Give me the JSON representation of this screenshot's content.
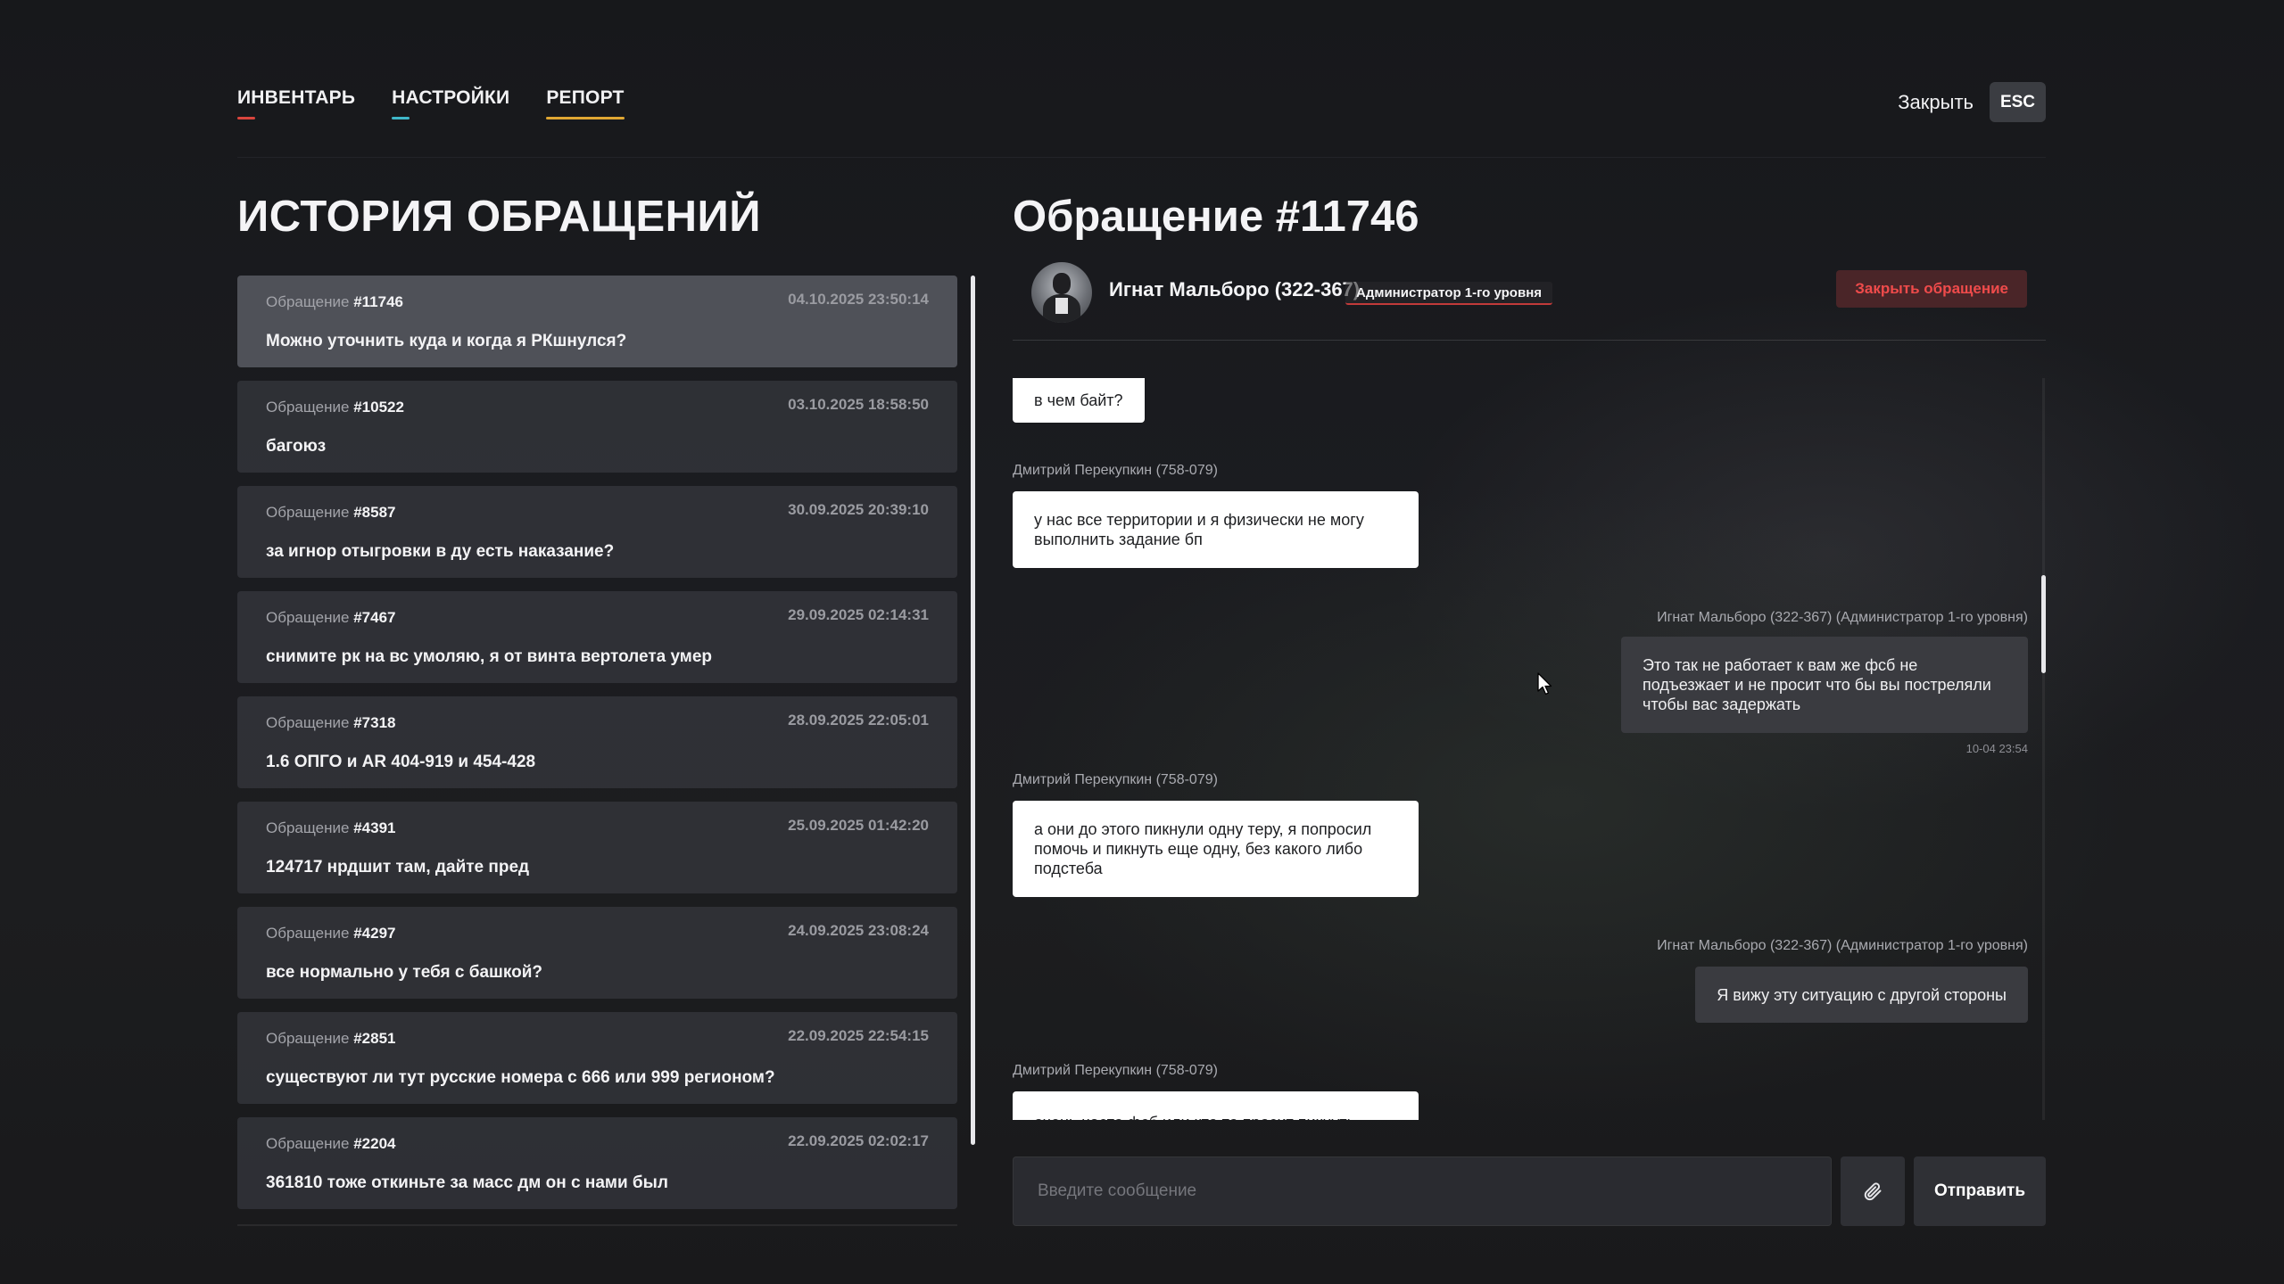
{
  "nav": {
    "tabs": [
      {
        "label": "ИНВЕНТАРЬ",
        "accent": "#d9453d"
      },
      {
        "label": "НАСТРОЙКИ",
        "accent": "#3fb7c9"
      },
      {
        "label": "РЕПОРТ",
        "accent": "#e0a733"
      }
    ],
    "close_label": "Закрыть",
    "esc_label": "ESC"
  },
  "history": {
    "title": "ИСТОРИЯ ОБРАЩЕНИЙ",
    "ticket_word": "Обращение",
    "items": [
      {
        "num": "#11746",
        "date": "04.10.2025 23:50:14",
        "text": "Можно уточнить куда и когда я РКшнулся?"
      },
      {
        "num": "#10522",
        "date": "03.10.2025 18:58:50",
        "text": "багоюз"
      },
      {
        "num": "#8587",
        "date": "30.09.2025 20:39:10",
        "text": "за игнор отыгровки в ду есть наказание?"
      },
      {
        "num": "#7467",
        "date": "29.09.2025 02:14:31",
        "text": "снимите рк на вс умоляю, я от винта вертолета умер"
      },
      {
        "num": "#7318",
        "date": "28.09.2025 22:05:01",
        "text": "1.6 ОПГО и AR 404-919 и 454-428"
      },
      {
        "num": "#4391",
        "date": "25.09.2025 01:42:20",
        "text": "124717 нрдшит там, дайте пред"
      },
      {
        "num": "#4297",
        "date": "24.09.2025 23:08:24",
        "text": "все нормально у тебя с башкой?"
      },
      {
        "num": "#2851",
        "date": "22.09.2025 22:54:15",
        "text": "существуют ли тут русские номера с 666 или 999 регионом?"
      },
      {
        "num": "#2204",
        "date": "22.09.2025 02:02:17",
        "text": "361810 тоже откиньте за масс дм он с нами был"
      }
    ]
  },
  "ticket": {
    "title": "Обращение #11746",
    "user_name": "Игнат Мальборо (322-367)",
    "user_role": "Администратор 1-го уровня",
    "close_button": "Закрыть обращение"
  },
  "messages": [
    {
      "text": "в чем байт?"
    },
    {
      "sender": "Дмитрий Перекупкин (758-079)",
      "lines": [
        "у нас все территории и я физически не могу",
        "выполнить задание бп"
      ]
    },
    {
      "sender": "Игнат Мальборо (322-367) (Администратор 1-го уровня)",
      "lines": [
        "Это так не работает к вам же фсб не",
        "подъезжает и не просит что бы вы постреляли",
        "чтобы вас задержать"
      ],
      "time": "10-04 23:54"
    },
    {
      "sender": "Дмитрий Перекупкин (758-079)",
      "lines": [
        "а они до этого пикнули одну теру, я попросил",
        "помочь и пикнуть еще одну, без какого либо",
        "подстеба"
      ]
    },
    {
      "sender": "Игнат Мальборо (322-367) (Администратор 1-го уровня)",
      "text": "Я вижу эту ситуацию с другой стороны"
    },
    {
      "sender": "Дмитрий Перекупкин (758-079)",
      "text": "очень часто фсб или кто то просит пикнуть"
    }
  ],
  "composer": {
    "placeholder": "Введите сообщение",
    "send_label": "Отправить"
  },
  "icons": {
    "attach": "paperclip-icon",
    "cursor": "mouse-pointer-icon"
  }
}
